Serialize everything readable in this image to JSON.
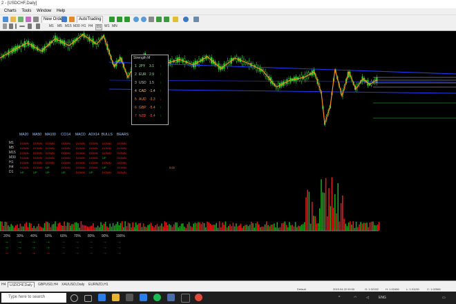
{
  "window": {
    "title": "2 - [USDCHF,Daily]"
  },
  "menu": [
    "Charts",
    "Tools",
    "Window",
    "Help"
  ],
  "toolbar": {
    "new_order": "New Order",
    "autotrading": "AutoTrading"
  },
  "timeframes": [
    "M1",
    "M5",
    "M15",
    "M30",
    "H1",
    "H4",
    "D1",
    "W1",
    "MN"
  ],
  "active_timeframe": "D1",
  "strength_panel": {
    "title": "Strength M",
    "rows": [
      {
        "rank": "1",
        "currency": "JPY",
        "value": "3.1",
        "dir": "up",
        "color": "#9ee59e"
      },
      {
        "rank": "2",
        "currency": "EUR",
        "value": "2.9",
        "dir": "up",
        "color": "#9ee59e"
      },
      {
        "rank": "3",
        "currency": "USD",
        "value": "1.5",
        "dir": "up",
        "color": "#cccccc"
      },
      {
        "rank": "4",
        "currency": "CAD",
        "value": "-1.4",
        "dir": "up",
        "color": "#ffd24d"
      },
      {
        "rank": "5",
        "currency": "AUD",
        "value": "-3.3",
        "dir": "down",
        "color": "#ff7f2a"
      },
      {
        "rank": "6",
        "currency": "GBP",
        "value": "-5.4",
        "dir": "up",
        "color": "#ff7f2a"
      },
      {
        "rank": "7",
        "currency": "NZD",
        "value": "-5.4",
        "dir": "up",
        "color": "#ff4d4d"
      }
    ]
  },
  "matrix": {
    "columns": [
      "MA20",
      "MA50",
      "MA100",
      "CCI14",
      "MACD",
      "ADX14",
      "BULLS",
      "BEARS"
    ],
    "rows": [
      {
        "label": "M1",
        "cells": [
          "DOWN",
          "DOWN",
          "DOWN",
          "DOWN",
          "DOWN",
          "DOWN",
          "DOWN",
          "DOWN"
        ]
      },
      {
        "label": "M5",
        "cells": [
          "DOWN",
          "DOWN",
          "DOWN",
          "DOWN",
          "DOWN",
          "DOWN",
          "DOWN",
          "DOWN"
        ]
      },
      {
        "label": "M15",
        "cells": [
          "DOWN",
          "DOWN",
          "DOWN",
          "DOWN",
          "DOWN",
          "DOWN",
          "DOWN",
          "DOWN"
        ]
      },
      {
        "label": "M30",
        "cells": [
          "DOWN",
          "DOWN",
          "DOWN",
          "DOWN",
          "DOWN",
          "DOWN",
          "UP",
          "DOWN"
        ]
      },
      {
        "label": "H1",
        "cells": [
          "DOWN",
          "DOWN",
          "DOWN",
          "DOWN",
          "DOWN",
          "DOWN",
          "DOWN",
          "DOWN"
        ]
      },
      {
        "label": "H4",
        "cells": [
          "DOWN",
          "DOWN",
          "UP",
          "DOWN",
          "DOWN",
          "DOWN",
          "UP",
          "DOWN"
        ]
      },
      {
        "label": "D1",
        "cells": [
          "UP",
          "UP",
          "UP",
          "UP",
          "DOWN",
          "UP",
          "DOWN",
          "DOWN"
        ]
      }
    ],
    "d1_value": "0.02"
  },
  "percentages": [
    "20%",
    "30%",
    "40%",
    "50%",
    "60%",
    "70%",
    "80%",
    "90%",
    "100%"
  ],
  "colors": {
    "up": "#22c422",
    "down": "#ff2020",
    "bull": "#1aa31a",
    "bear": "#e01818",
    "resistance": "#1e3cff",
    "zigzag": "#ff8c1a",
    "candle": "#2ad42a"
  },
  "tabs": [
    "H4",
    "USDCHF,Daily",
    "GBPUSD,H4",
    "XAUUSD,Daily",
    "EURNZD,H1"
  ],
  "active_tab": "USDCHF,Daily",
  "status": {
    "profile": "Default",
    "datetime": "2019.04.22 00:00",
    "o": "O: 1.02152",
    "h": "H: 1.02406",
    "l": "L: 1.01139",
    "c": "C: 1.02566"
  },
  "taskbar": {
    "search_placeholder": "Type here to search"
  }
}
